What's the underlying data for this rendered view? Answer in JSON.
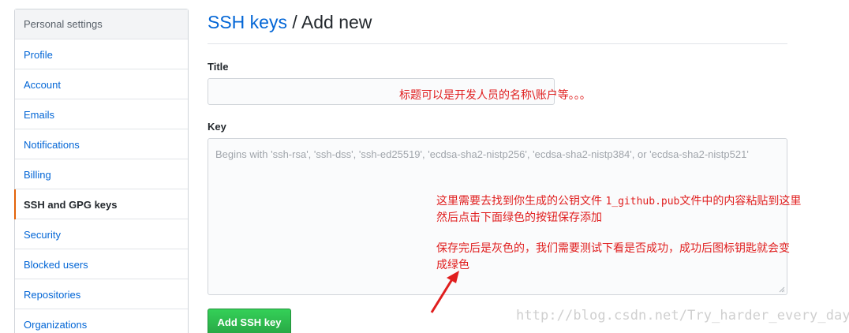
{
  "sidebar": {
    "header": "Personal settings",
    "items": [
      {
        "label": "Profile"
      },
      {
        "label": "Account"
      },
      {
        "label": "Emails"
      },
      {
        "label": "Notifications"
      },
      {
        "label": "Billing"
      },
      {
        "label": "SSH and GPG keys",
        "selected": true
      },
      {
        "label": "Security"
      },
      {
        "label": "Blocked users"
      },
      {
        "label": "Repositories"
      },
      {
        "label": "Organizations"
      }
    ]
  },
  "main": {
    "title_link": "SSH keys",
    "title_separator": "/",
    "title_rest": "Add new",
    "title_field_label": "Title",
    "title_value": "",
    "key_field_label": "Key",
    "key_placeholder": "Begins with 'ssh-rsa', 'ssh-dss', 'ssh-ed25519', 'ecdsa-sha2-nistp256', 'ecdsa-sha2-nistp384', or 'ecdsa-sha2-nistp521'",
    "add_button_label": "Add SSH key"
  },
  "annotations": {
    "title_note": "标题可以是开发人员的名称\\账户等。。。",
    "key_note_line1_a": "这里需要去找到你生成的公钥文件 ",
    "key_note_line1_file": "1_github.pub",
    "key_note_line1_b": "文件中的内容粘贴到这里",
    "key_note_line2": "然后点击下面绿色的按钮保存添加",
    "key_note_line3": "保存完后是灰色的，我们需要测试下看是否成功，成功后图标钥匙就会变",
    "key_note_line4": "成绿色"
  },
  "watermark": "http://blog.csdn.net/Try_harder_every_day",
  "colors": {
    "link": "#0366d6",
    "selected_marker": "#e36209",
    "button_green": "#28a745",
    "annotation_red": "#e01e1e"
  }
}
